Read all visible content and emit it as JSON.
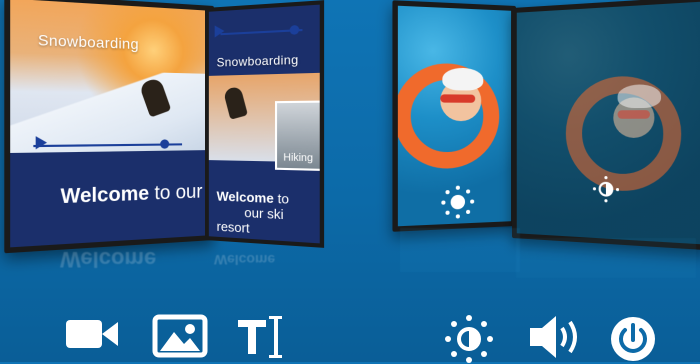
{
  "screens": {
    "s1": {
      "title": "Snowboarding",
      "welcome_bold": "Welcome",
      "welcome_rest": " to our"
    },
    "s2": {
      "title": "Snowboarding",
      "hiking": "Hiking",
      "welcome_bold": "Welcome",
      "welcome_rest": " to",
      "welcome_line2": "our ski resort"
    },
    "reflection_text": "Welcome"
  },
  "toolbar": {
    "icons": [
      "video-icon",
      "image-icon",
      "text-cursor-icon",
      "brightness-icon",
      "volume-icon",
      "power-icon"
    ]
  },
  "colors": {
    "background": "#0c6aa8",
    "accent_dark": "#1b2f6b",
    "accent_slider": "#1b3f9a",
    "ring": "#f06a2c"
  }
}
